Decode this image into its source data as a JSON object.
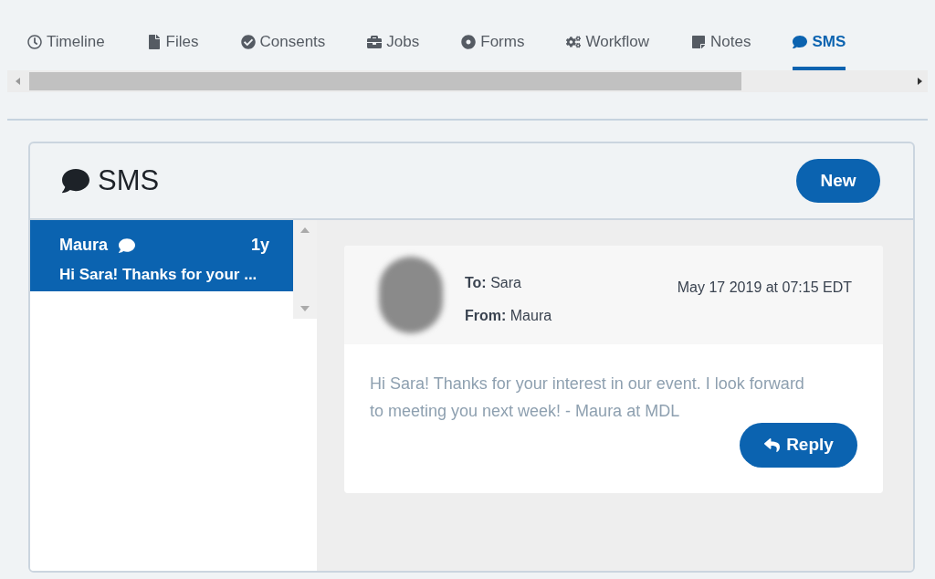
{
  "tabs": [
    {
      "label": "Timeline",
      "selected": false
    },
    {
      "label": "Files",
      "selected": false
    },
    {
      "label": "Consents",
      "selected": false
    },
    {
      "label": "Jobs",
      "selected": false
    },
    {
      "label": "Forms",
      "selected": false
    },
    {
      "label": "Workflow",
      "selected": false
    },
    {
      "label": "Notes",
      "selected": false
    },
    {
      "label": "SMS",
      "selected": true
    }
  ],
  "panel": {
    "title": "SMS",
    "new_button": "New"
  },
  "conversations": [
    {
      "name": "Maura",
      "age": "1y",
      "preview": "Hi Sara! Thanks for your ...",
      "selected": true
    }
  ],
  "message": {
    "to_label": "To:",
    "to": "Sara",
    "from_label": "From:",
    "from": "Maura",
    "date": "May 17 2019 at 07:15 EDT",
    "body": "Hi Sara! Thanks for your interest in our event. I look forward to meeting you next week! - Maura at MDL",
    "reply_button": "Reply"
  }
}
